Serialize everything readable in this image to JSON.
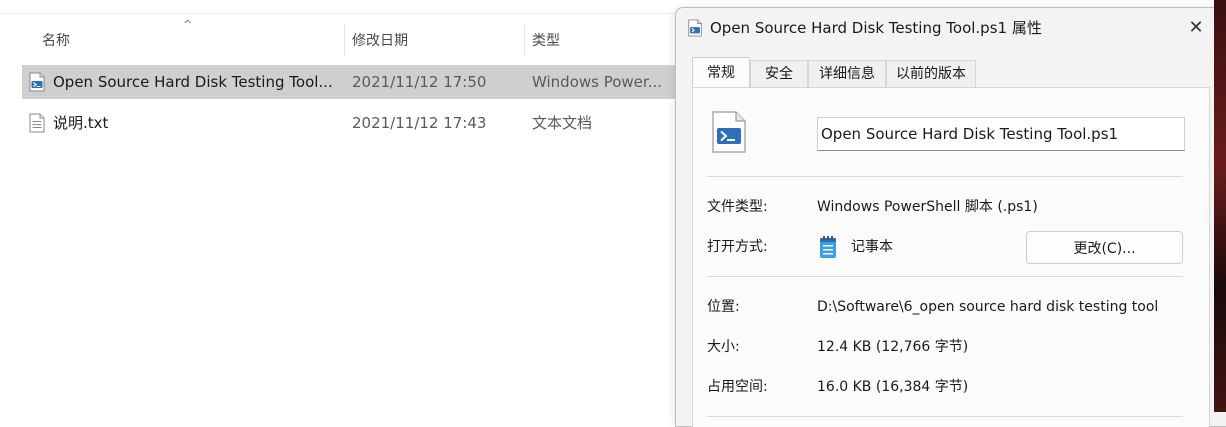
{
  "explorer": {
    "columns": {
      "name": "名称",
      "date": "修改日期",
      "type": "类型"
    },
    "sort_indicator": "^",
    "files": [
      {
        "name": "Open Source Hard Disk Testing Tool....",
        "date": "2021/11/12 17:50",
        "type": "Windows Power...",
        "icon": "powershell-script-icon",
        "selected": true
      },
      {
        "name": "说明.txt",
        "date": "2021/11/12 17:43",
        "type": "文本文档",
        "icon": "text-file-icon",
        "selected": false
      }
    ]
  },
  "dialog": {
    "title": "Open Source Hard Disk Testing Tool.ps1 属性",
    "close_glyph": "✕",
    "tabs": [
      {
        "label": "常规",
        "active": true
      },
      {
        "label": "安全",
        "active": false
      },
      {
        "label": "详细信息",
        "active": false
      },
      {
        "label": "以前的版本",
        "active": false
      }
    ],
    "filename_value": "Open Source Hard Disk Testing Tool.ps1",
    "file_type_label": "文件类型:",
    "file_type_value": "Windows PowerShell 脚本 (.ps1)",
    "open_with_label": "打开方式:",
    "open_with_value": "记事本",
    "change_button_label": "更改(C)...",
    "location_label": "位置:",
    "location_value": "D:\\Software\\6_open source hard disk testing tool",
    "size_label": "大小:",
    "size_value": "12.4 KB (12,766 字节)",
    "size_on_disk_label": "占用空间:",
    "size_on_disk_value": "16.0 KB (16,384 字节)"
  },
  "colors": {
    "selection": "#cfcfcf",
    "dialog_bg": "#f3f3f3",
    "panel_bg": "#fbfbfb",
    "powershell_blue": "#2d6fb8"
  }
}
